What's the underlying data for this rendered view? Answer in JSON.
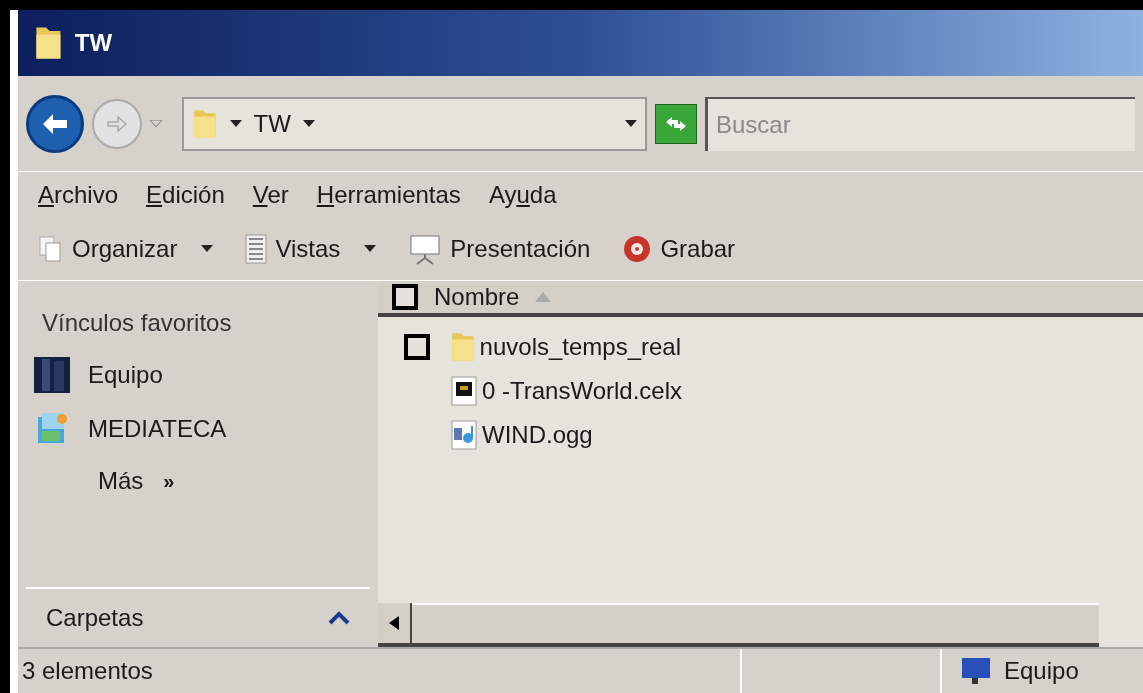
{
  "window": {
    "title": "TW"
  },
  "address_bar": {
    "path": "TW",
    "search": {
      "placeholder": "Buscar"
    }
  },
  "menu": [
    {
      "key": "A",
      "post": "rchivo"
    },
    {
      "key": "E",
      "post": "dición"
    },
    {
      "key": "V",
      "post": "er"
    },
    {
      "key": "H",
      "post": "erramientas"
    },
    {
      "pre": "Ay",
      "key": "u",
      "post": "da"
    }
  ],
  "toolbar": [
    {
      "kind": "organize",
      "label": "Organizar",
      "dropdown": true
    },
    {
      "kind": "views",
      "label": "Vistas",
      "dropdown": true
    },
    {
      "kind": "slideshow",
      "label": "Presentación",
      "dropdown": false
    },
    {
      "kind": "burn",
      "label": "Grabar",
      "dropdown": false
    }
  ],
  "sidebar": {
    "heading": "Vínculos favoritos",
    "items": [
      {
        "kind": "computer",
        "label": "Equipo"
      },
      {
        "kind": "media",
        "label": "MEDIATECA"
      }
    ],
    "more": {
      "label": "Más",
      "chevron": "»"
    },
    "folders": {
      "label": "Carpetas"
    }
  },
  "file_list": {
    "columns": [
      {
        "label": "Nombre",
        "sorted": true,
        "checkbox": {
          "checked": false
        }
      }
    ],
    "rows": [
      {
        "kind": "folder",
        "name": "nuvols_temps_real",
        "checkbox": {
          "checked": false
        }
      },
      {
        "kind": "celx",
        "name": "0 -TransWorld.celx"
      },
      {
        "kind": "audio",
        "name": "WIND.ogg"
      }
    ]
  },
  "status_bar": {
    "count": "3 elementos",
    "location": "Equipo"
  }
}
